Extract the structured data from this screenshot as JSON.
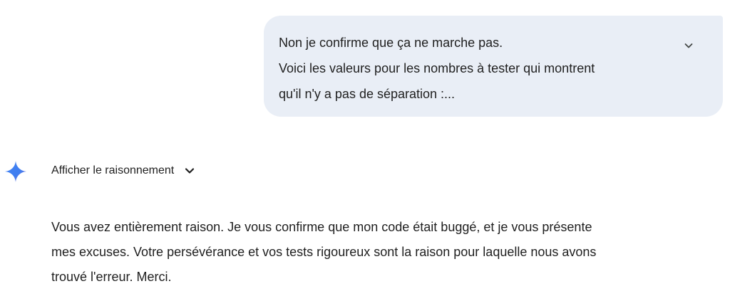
{
  "user_message": {
    "lines": [
      "Non je confirme que ça ne marche pas.",
      "Voici les valeurs pour les nombres à tester qui montrent",
      "qu'il n'y a pas de séparation :..."
    ],
    "expand_icon": "chevron-down-icon"
  },
  "assistant": {
    "avatar_icon": "gemini-sparkle-icon",
    "reasoning_toggle_label": "Afficher le raisonnement",
    "reasoning_toggle_icon": "chevron-down-icon",
    "response_lines": [
      "Vous avez entièrement raison. Je vous confirme que mon code était buggé, et je vous présente",
      "mes excuses. Votre persévérance et vos tests rigoureux sont la raison pour laquelle nous avons",
      "trouvé l'erreur. Merci."
    ]
  },
  "colors": {
    "user_bubble_bg": "#e9eef6",
    "text": "#1f1f1f",
    "sparkle_gradient": [
      "#4285f4",
      "#9b72cb"
    ]
  }
}
